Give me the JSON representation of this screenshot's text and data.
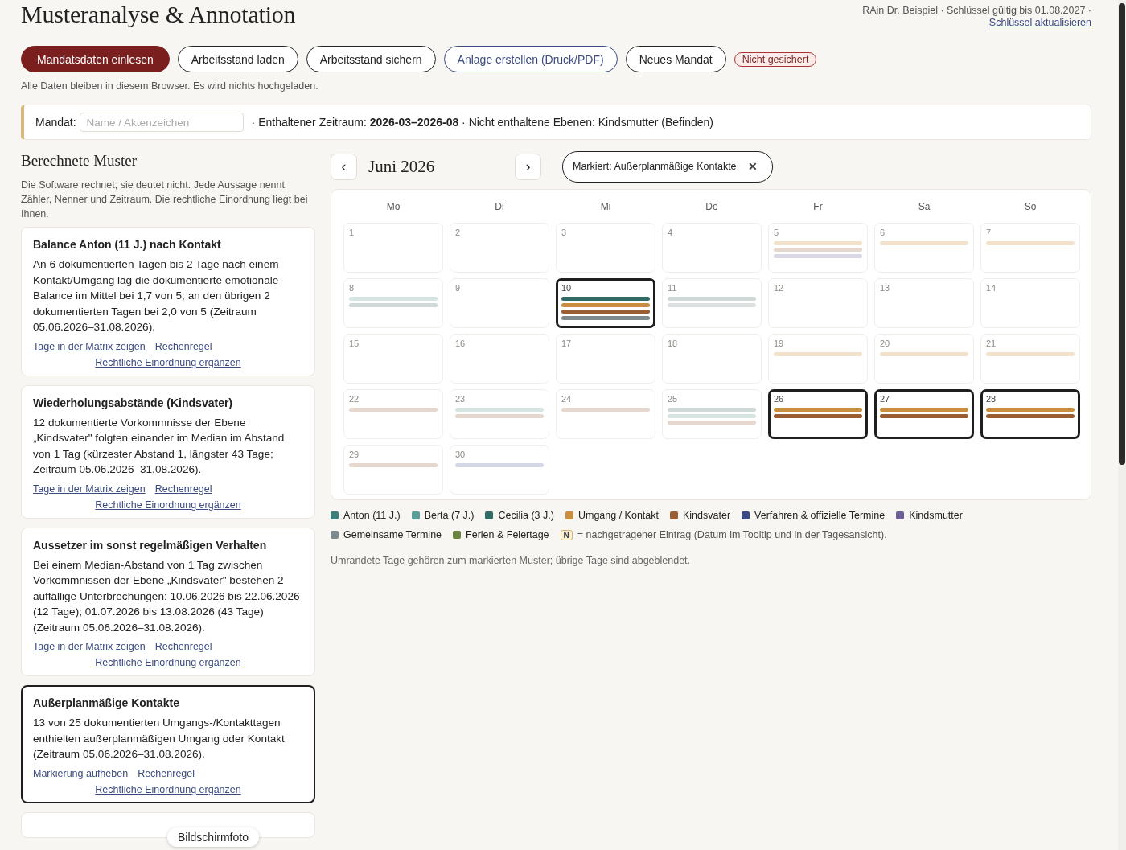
{
  "header": {
    "title": "Musteranalyse & Annotation",
    "account_line": "RAin Dr. Beispiel · Schlüssel gültig bis 01.08.2027 ·",
    "account_link": "Schlüssel aktualisieren"
  },
  "toolbar": {
    "buttons": [
      {
        "label": "Mandatsdaten einlesen",
        "kind": "primary"
      },
      {
        "label": "Arbeitsstand laden",
        "kind": "outline"
      },
      {
        "label": "Arbeitsstand sichern",
        "kind": "outline"
      },
      {
        "label": "Anlage erstellen (Druck/PDF)",
        "kind": "accent"
      },
      {
        "label": "Neues Mandat",
        "kind": "outline"
      }
    ],
    "status_badge": "Nicht gesichert",
    "note": "Alle Daten bleiben in diesem Browser. Es wird nichts hochgeladen."
  },
  "mandate": {
    "label": "Mandat:",
    "placeholder": "Name / Aktenzeichen",
    "summary": "· Enthaltener Zeitraum: **2026-03–2026-08** · Nicht enthaltene Ebenen: Kindsmutter (Befinden)"
  },
  "patterns": {
    "title": "Berechnete Muster",
    "intro": "Die Software rechnet, sie deutet nicht. Jede Aussage nennt Zähler, Nenner und Zeitraum. Die rechtliche Einordnung liegt bei Ihnen.",
    "cards": [
      {
        "title": "Balance Anton (11 J.) nach Kontakt",
        "text": "An 6 dokumentierten Tagen bis 2 Tage nach einem Kontakt/Umgang lag die dokumentierte emotionale Balance im Mittel bei 1,7 von 5; an den übrigen 2 dokumentierten Tagen bei 2,0 von 5 (Zeitraum 05.06.2026–31.08.2026).",
        "selected": false,
        "links": [
          "Tage in der Matrix zeigen",
          "Rechenregel",
          "Rechtliche Einordnung ergänzen"
        ]
      },
      {
        "title": "Wiederholungsabstände (Kindsvater)",
        "text": "12 dokumentierte Vorkommnisse der Ebene „Kindsvater\" folgten einander im Median im Abstand von 1 Tag (kürzester Abstand 1, längster 43 Tage; Zeitraum 05.06.2026–31.08.2026).",
        "selected": false,
        "links": [
          "Tage in der Matrix zeigen",
          "Rechenregel",
          "Rechtliche Einordnung ergänzen"
        ]
      },
      {
        "title": "Aussetzer im sonst regelmäßigen Verhalten",
        "text": "Bei einem Median-Abstand von 1 Tag zwischen Vorkommnissen der Ebene „Kindsvater\" bestehen 2 auffällige Unterbrechungen: 10.06.2026 bis 22.06.2026 (12 Tage); 01.07.2026 bis 13.08.2026 (43 Tage) (Zeitraum 05.06.2026–31.08.2026).",
        "selected": false,
        "links": [
          "Tage in der Matrix zeigen",
          "Rechenregel",
          "Rechtliche Einordnung ergänzen"
        ]
      },
      {
        "title": "Außerplanmäßige Kontakte",
        "text": "13 von 25 dokumentierten Umgangs-/Kontakttagen enthielten außerplanmäßigen Umgang oder Kontakt (Zeitraum 05.06.2026–31.08.2026).",
        "selected": true,
        "links": [
          "Markierung aufheben",
          "Rechenregel",
          "Rechtliche Einordnung ergänzen"
        ]
      }
    ]
  },
  "calendar": {
    "prev": "‹",
    "month": "Juni 2026",
    "next": "›",
    "marker_chip": "Markiert: Außerplanmäßige Kontakte",
    "chip_close": "✕",
    "weekdays": [
      "Mo",
      "Di",
      "Mi",
      "Do",
      "Fr",
      "Sa",
      "So"
    ],
    "days": [
      {
        "day": "1",
        "marked": false
      },
      {
        "day": "2",
        "marked": false
      },
      {
        "day": "3",
        "marked": false
      },
      {
        "day": "4",
        "marked": false
      },
      {
        "day": "5",
        "marked": false,
        "bars": [
          {
            "color": "#f2e2cc"
          },
          {
            "color": "#e6d8ce"
          },
          {
            "color": "#dcd7e6"
          }
        ]
      },
      {
        "day": "6",
        "marked": false,
        "bars": [
          {
            "color": "#f2e2cc"
          }
        ]
      },
      {
        "day": "7",
        "marked": false,
        "bars": [
          {
            "color": "#f2e2cc"
          }
        ]
      },
      {
        "day": "8",
        "marked": false,
        "bars": [
          {
            "color": "#d6e5e2"
          },
          {
            "color": "#cfdad8"
          }
        ]
      },
      {
        "day": "9",
        "marked": false
      },
      {
        "day": "10",
        "marked": true,
        "bars": [
          {
            "color": "#2f6a64"
          },
          {
            "color": "#c98f3e"
          },
          {
            "color": "#9a5e34"
          },
          {
            "color": "#7f8a8e"
          }
        ]
      },
      {
        "day": "11",
        "marked": false,
        "bars": [
          {
            "color": "#cfdad8"
          },
          {
            "color": "#dde0e1"
          }
        ]
      },
      {
        "day": "12",
        "marked": false
      },
      {
        "day": "13",
        "marked": false
      },
      {
        "day": "14",
        "marked": false
      },
      {
        "day": "15",
        "marked": false
      },
      {
        "day": "16",
        "marked": false
      },
      {
        "day": "17",
        "marked": false
      },
      {
        "day": "18",
        "marked": false
      },
      {
        "day": "19",
        "marked": false,
        "bars": [
          {
            "color": "#f2e2cc"
          }
        ]
      },
      {
        "day": "20",
        "marked": false,
        "bars": [
          {
            "color": "#f2e2cc"
          }
        ]
      },
      {
        "day": "21",
        "marked": false,
        "bars": [
          {
            "color": "#f2e2cc"
          }
        ]
      },
      {
        "day": "22",
        "marked": false,
        "bars": [
          {
            "color": "#e6d8ce"
          }
        ]
      },
      {
        "day": "23",
        "marked": false,
        "bars": [
          {
            "color": "#d6e5e2"
          },
          {
            "color": "#e6d8ce"
          }
        ]
      },
      {
        "day": "24",
        "marked": false,
        "bars": [
          {
            "color": "#e6d8ce"
          }
        ]
      },
      {
        "day": "25",
        "marked": false,
        "bars": [
          {
            "color": "#cfdad8"
          },
          {
            "color": "#d6e5e2"
          },
          {
            "color": "#e6d8ce"
          }
        ]
      },
      {
        "day": "26",
        "marked": true,
        "bars": [
          {
            "color": "#c98f3e"
          },
          {
            "color": "#9a5e34"
          }
        ]
      },
      {
        "day": "27",
        "marked": true,
        "bars": [
          {
            "color": "#c98f3e"
          },
          {
            "color": "#9a5e34"
          }
        ]
      },
      {
        "day": "28",
        "marked": true,
        "bars": [
          {
            "color": "#c98f3e"
          },
          {
            "color": "#9a5e34"
          }
        ]
      },
      {
        "day": "29",
        "marked": false,
        "bars": [
          {
            "color": "#e6d8ce"
          }
        ]
      },
      {
        "day": "30",
        "marked": false,
        "bars": [
          {
            "color": "#d4d8e6"
          }
        ]
      }
    ],
    "legend": [
      {
        "label": "Anton (11 J.)",
        "color": "#3f7f7a"
      },
      {
        "label": "Berta (7 J.)",
        "color": "#5a9e98"
      },
      {
        "label": "Cecilia (3 J.)",
        "color": "#2f6a64"
      },
      {
        "label": "Umgang / Kontakt",
        "color": "#c98f3e"
      },
      {
        "label": "Kindsvater",
        "color": "#9a5e34"
      },
      {
        "label": "Verfahren & offizielle Termine",
        "color": "#3b4a80"
      },
      {
        "label": "Kindsmutter",
        "color": "#6e5f96"
      },
      {
        "label": "Gemeinsame Termine",
        "color": "#7f8a8e"
      },
      {
        "label": "Ferien & Feiertage",
        "color": "#6b8440"
      }
    ],
    "late_entry": {
      "badge": "N",
      "text": "= nachgetragener Eintrag (Datum im Tooltip und in der Tagesansicht)."
    },
    "footnote": "Umrandete Tage gehören zum markierten Muster; übrige Tage sind abgeblendet."
  },
  "tooltip": "Bildschirmfoto"
}
